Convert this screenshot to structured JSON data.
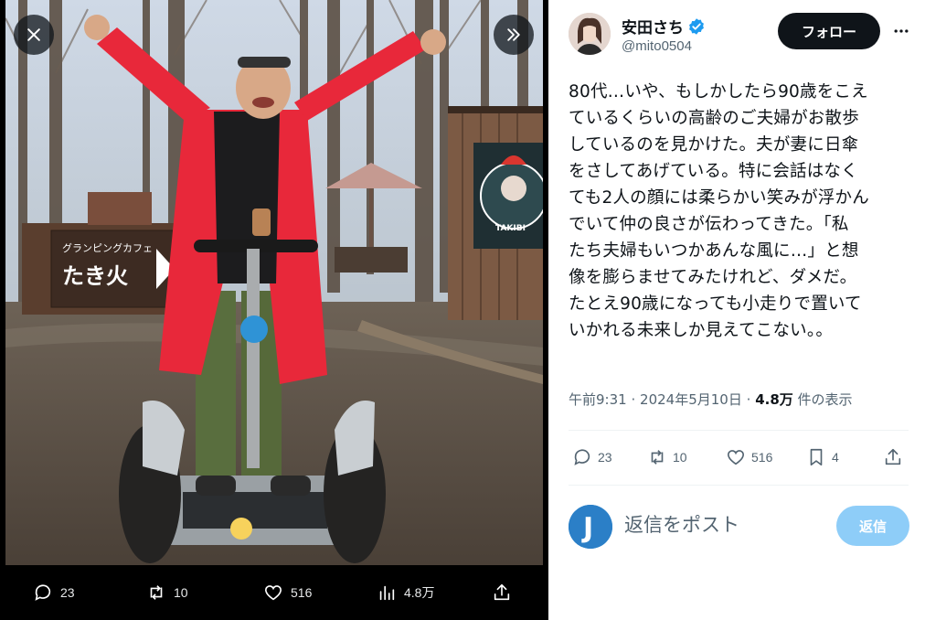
{
  "viewer": {
    "image_alt": "Man in red coat on a segway in a glamping forest",
    "sign_text": "グランピングカフェ たき火",
    "logo_text": "GLAMPING TAKIBI",
    "actions": {
      "reply_count": "23",
      "retweet_count": "10",
      "like_count": "516",
      "view_count": "4.8万"
    }
  },
  "tweet": {
    "display_name": "安田さち",
    "handle": "@mito0504",
    "follow_label": "フォロー",
    "text": "80代…いや、もしかしたら90歳をこえ\nているくらいの高齢のご夫婦がお散歩\nしているのを見かけた。夫が妻に日傘\nをさしてあげている。特に会話はなく\nても2人の顔には柔らかい笑みが浮かん\nでいて仲の良さが伝わってきた。「私\nたち夫婦もいつかあんな風に…」と想\n像を膨らませてみたけれど、ダメだ。\nたとえ90歳になっても小走りで置いて\nいかれる未来しか見えてこない。。",
    "time": "午前9:31",
    "date": "2024年5月10日",
    "views_number": "4.8万",
    "views_suffix": "件の表示",
    "separator": "·",
    "actions": {
      "reply_count": "23",
      "retweet_count": "10",
      "like_count": "516",
      "bookmark_count": "4"
    }
  },
  "reply": {
    "placeholder": "返信をポスト",
    "button_label": "返信",
    "avatar_letter": "J"
  },
  "colors": {
    "accent": "#1d9bf0",
    "follow_bg": "#0f1419",
    "reply_btn_bg": "#8ecdf8",
    "muted_text": "#536471",
    "coat_red": "#e8283a"
  }
}
